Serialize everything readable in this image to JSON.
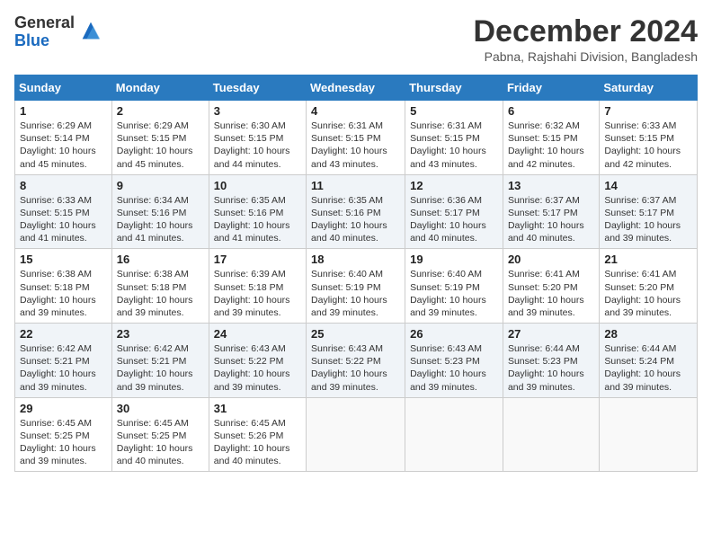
{
  "logo": {
    "general": "General",
    "blue": "Blue"
  },
  "title": "December 2024",
  "location": "Pabna, Rajshahi Division, Bangladesh",
  "weekdays": [
    "Sunday",
    "Monday",
    "Tuesday",
    "Wednesday",
    "Thursday",
    "Friday",
    "Saturday"
  ],
  "weeks": [
    [
      {
        "day": "1",
        "info": "Sunrise: 6:29 AM\nSunset: 5:14 PM\nDaylight: 10 hours\nand 45 minutes."
      },
      {
        "day": "2",
        "info": "Sunrise: 6:29 AM\nSunset: 5:15 PM\nDaylight: 10 hours\nand 45 minutes."
      },
      {
        "day": "3",
        "info": "Sunrise: 6:30 AM\nSunset: 5:15 PM\nDaylight: 10 hours\nand 44 minutes."
      },
      {
        "day": "4",
        "info": "Sunrise: 6:31 AM\nSunset: 5:15 PM\nDaylight: 10 hours\nand 43 minutes."
      },
      {
        "day": "5",
        "info": "Sunrise: 6:31 AM\nSunset: 5:15 PM\nDaylight: 10 hours\nand 43 minutes."
      },
      {
        "day": "6",
        "info": "Sunrise: 6:32 AM\nSunset: 5:15 PM\nDaylight: 10 hours\nand 42 minutes."
      },
      {
        "day": "7",
        "info": "Sunrise: 6:33 AM\nSunset: 5:15 PM\nDaylight: 10 hours\nand 42 minutes."
      }
    ],
    [
      {
        "day": "8",
        "info": "Sunrise: 6:33 AM\nSunset: 5:15 PM\nDaylight: 10 hours\nand 41 minutes."
      },
      {
        "day": "9",
        "info": "Sunrise: 6:34 AM\nSunset: 5:16 PM\nDaylight: 10 hours\nand 41 minutes."
      },
      {
        "day": "10",
        "info": "Sunrise: 6:35 AM\nSunset: 5:16 PM\nDaylight: 10 hours\nand 41 minutes."
      },
      {
        "day": "11",
        "info": "Sunrise: 6:35 AM\nSunset: 5:16 PM\nDaylight: 10 hours\nand 40 minutes."
      },
      {
        "day": "12",
        "info": "Sunrise: 6:36 AM\nSunset: 5:17 PM\nDaylight: 10 hours\nand 40 minutes."
      },
      {
        "day": "13",
        "info": "Sunrise: 6:37 AM\nSunset: 5:17 PM\nDaylight: 10 hours\nand 40 minutes."
      },
      {
        "day": "14",
        "info": "Sunrise: 6:37 AM\nSunset: 5:17 PM\nDaylight: 10 hours\nand 39 minutes."
      }
    ],
    [
      {
        "day": "15",
        "info": "Sunrise: 6:38 AM\nSunset: 5:18 PM\nDaylight: 10 hours\nand 39 minutes."
      },
      {
        "day": "16",
        "info": "Sunrise: 6:38 AM\nSunset: 5:18 PM\nDaylight: 10 hours\nand 39 minutes."
      },
      {
        "day": "17",
        "info": "Sunrise: 6:39 AM\nSunset: 5:18 PM\nDaylight: 10 hours\nand 39 minutes."
      },
      {
        "day": "18",
        "info": "Sunrise: 6:40 AM\nSunset: 5:19 PM\nDaylight: 10 hours\nand 39 minutes."
      },
      {
        "day": "19",
        "info": "Sunrise: 6:40 AM\nSunset: 5:19 PM\nDaylight: 10 hours\nand 39 minutes."
      },
      {
        "day": "20",
        "info": "Sunrise: 6:41 AM\nSunset: 5:20 PM\nDaylight: 10 hours\nand 39 minutes."
      },
      {
        "day": "21",
        "info": "Sunrise: 6:41 AM\nSunset: 5:20 PM\nDaylight: 10 hours\nand 39 minutes."
      }
    ],
    [
      {
        "day": "22",
        "info": "Sunrise: 6:42 AM\nSunset: 5:21 PM\nDaylight: 10 hours\nand 39 minutes."
      },
      {
        "day": "23",
        "info": "Sunrise: 6:42 AM\nSunset: 5:21 PM\nDaylight: 10 hours\nand 39 minutes."
      },
      {
        "day": "24",
        "info": "Sunrise: 6:43 AM\nSunset: 5:22 PM\nDaylight: 10 hours\nand 39 minutes."
      },
      {
        "day": "25",
        "info": "Sunrise: 6:43 AM\nSunset: 5:22 PM\nDaylight: 10 hours\nand 39 minutes."
      },
      {
        "day": "26",
        "info": "Sunrise: 6:43 AM\nSunset: 5:23 PM\nDaylight: 10 hours\nand 39 minutes."
      },
      {
        "day": "27",
        "info": "Sunrise: 6:44 AM\nSunset: 5:23 PM\nDaylight: 10 hours\nand 39 minutes."
      },
      {
        "day": "28",
        "info": "Sunrise: 6:44 AM\nSunset: 5:24 PM\nDaylight: 10 hours\nand 39 minutes."
      }
    ],
    [
      {
        "day": "29",
        "info": "Sunrise: 6:45 AM\nSunset: 5:25 PM\nDaylight: 10 hours\nand 39 minutes."
      },
      {
        "day": "30",
        "info": "Sunrise: 6:45 AM\nSunset: 5:25 PM\nDaylight: 10 hours\nand 40 minutes."
      },
      {
        "day": "31",
        "info": "Sunrise: 6:45 AM\nSunset: 5:26 PM\nDaylight: 10 hours\nand 40 minutes."
      },
      null,
      null,
      null,
      null
    ]
  ]
}
